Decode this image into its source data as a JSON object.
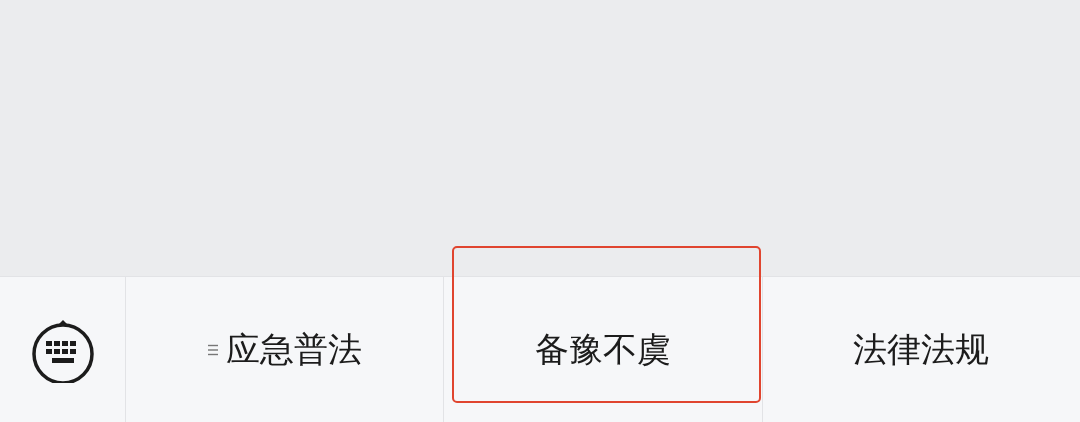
{
  "menu_bar": {
    "items": [
      {
        "label": "应急普法",
        "has_submenu": true,
        "highlighted": false
      },
      {
        "label": "备豫不虞",
        "has_submenu": false,
        "highlighted": true
      },
      {
        "label": "法律法规",
        "has_submenu": false,
        "highlighted": false
      }
    ]
  }
}
